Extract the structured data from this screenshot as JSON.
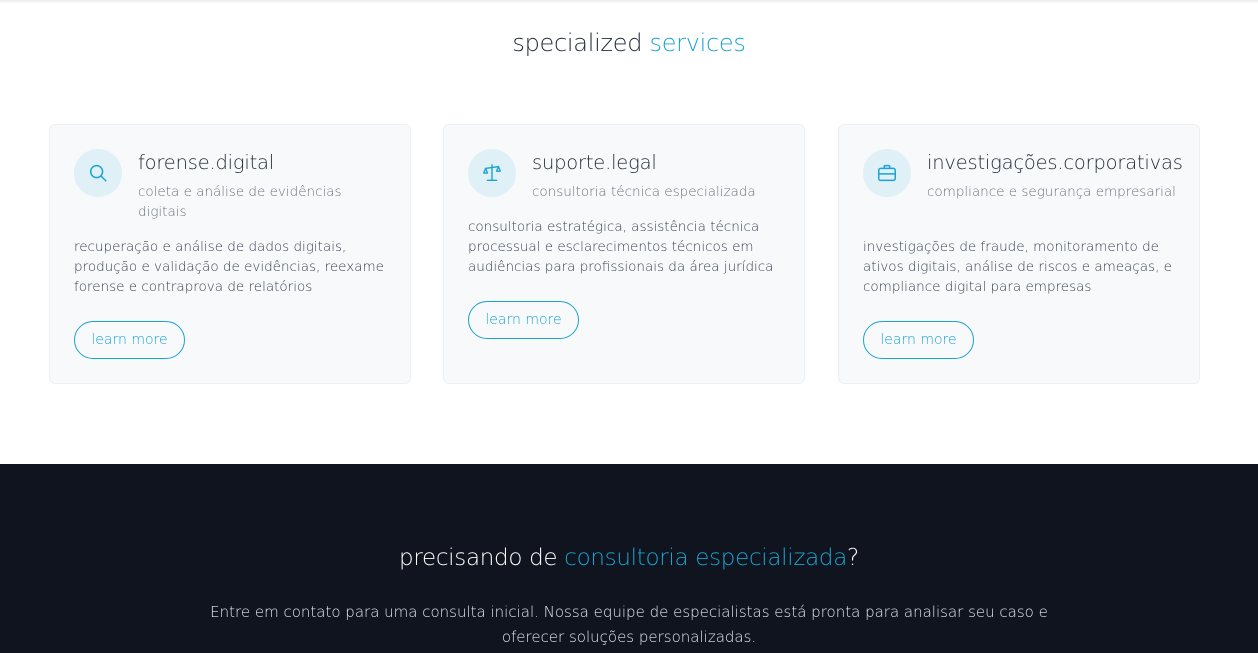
{
  "services": {
    "title_plain": "specialized",
    "title_accent": "services",
    "cards": [
      {
        "icon": "search-icon",
        "title": "forense.digital",
        "subtitle": "coleta e análise de evidências digitais",
        "description": "recuperação e análise de dados digitais, produção e validação de evidências, reexame forense e contraprova de relatórios",
        "button_label": "learn more"
      },
      {
        "icon": "scale-icon",
        "title": "suporte.legal",
        "subtitle": "consultoria técnica especializada",
        "description": "consultoria estratégica, assistência técnica processual e esclarecimentos técnicos em audiências para profissionais da área jurídica",
        "button_label": "learn more"
      },
      {
        "icon": "briefcase-icon",
        "title": "investigações.corporativas",
        "subtitle": "compliance e segurança empresarial",
        "description": "investigações de fraude, monitoramento de ativos digitais, análise de riscos e ameaças, e compliance digital para empresas",
        "button_label": "learn more"
      }
    ]
  },
  "cta": {
    "title_plain": "precisando de",
    "title_accent": "consultoria especializada",
    "title_suffix": "?",
    "text": "Entre em contato para uma consulta inicial. Nossa equipe de especialistas está pronta para analisar seu caso e oferecer soluções personalizadas."
  },
  "colors": {
    "accent": "#1ba3d1",
    "card_bg": "#f7f9fb",
    "icon_bg": "#dff0f6",
    "cta_bg": "#0f141f"
  }
}
